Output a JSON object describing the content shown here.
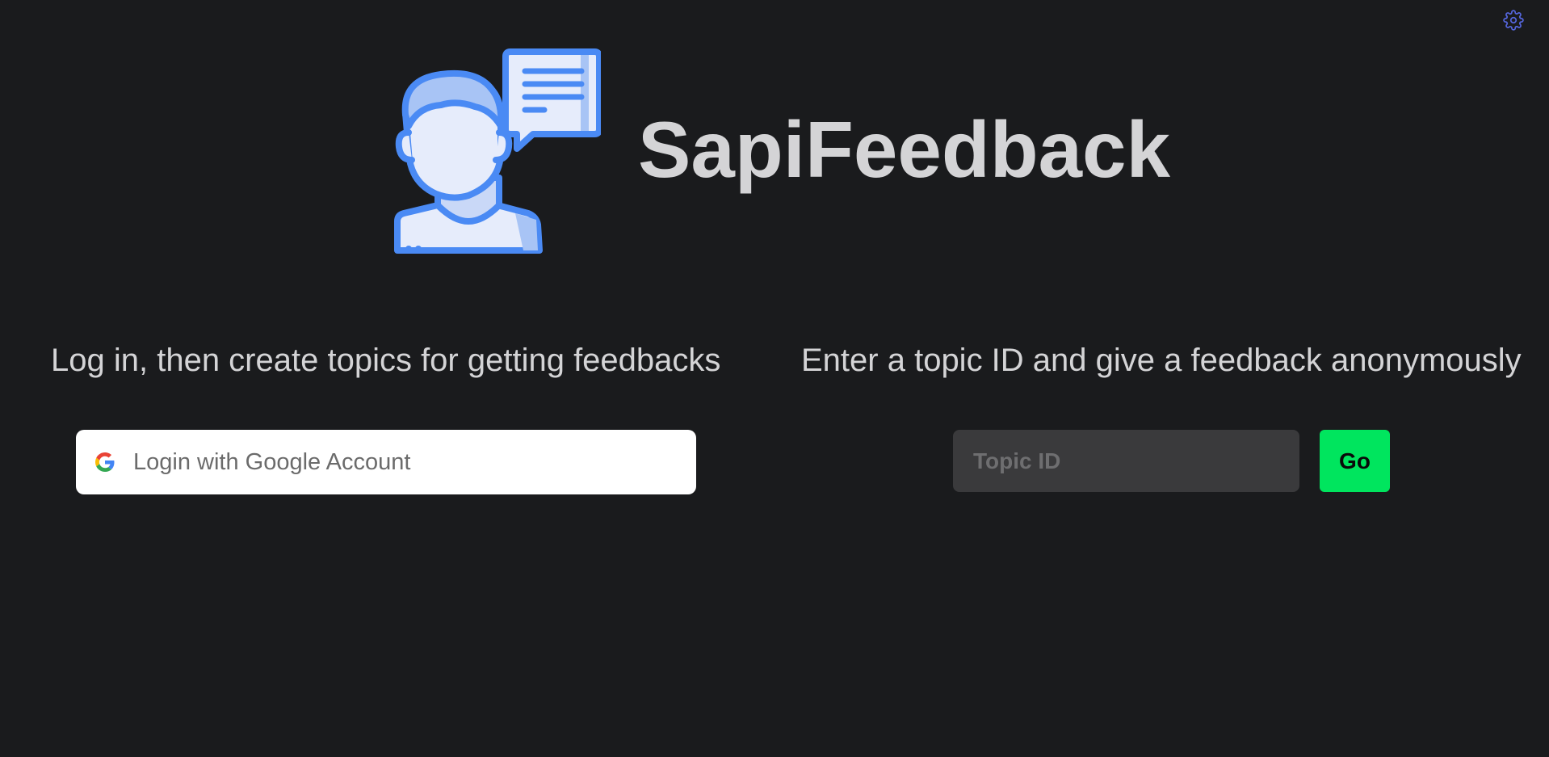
{
  "app": {
    "title": "SapiFeedback"
  },
  "header": {
    "settings_icon": "gear-icon",
    "logo_icon": "person-speech-bubble-icon"
  },
  "login_section": {
    "tagline": "Log in, then create topics for getting feedbacks",
    "google_button_label": "Login with Google Account",
    "google_icon": "google-g-icon"
  },
  "anonymous_section": {
    "tagline": "Enter a topic ID and give a feedback anonymously",
    "topic_input": {
      "placeholder": "Topic ID",
      "value": ""
    },
    "go_button_label": "Go"
  },
  "colors": {
    "background": "#1a1b1d",
    "text": "#d4d4d6",
    "accent_blue": "#4a8af4",
    "go_green": "#00e55e",
    "input_bg": "#3a3a3c"
  }
}
